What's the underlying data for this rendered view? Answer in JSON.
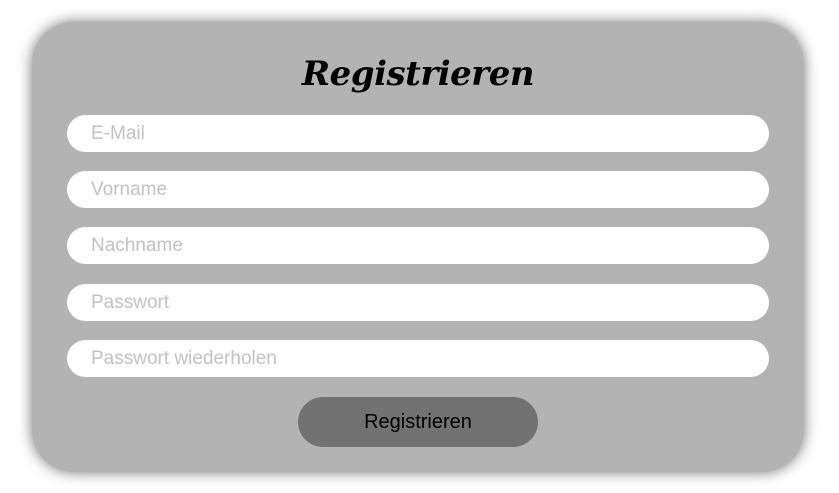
{
  "form": {
    "title": "Registrieren",
    "fields": [
      {
        "placeholder": "E-Mail",
        "value": ""
      },
      {
        "placeholder": "Vorname",
        "value": ""
      },
      {
        "placeholder": "Nachname",
        "value": ""
      },
      {
        "placeholder": "Passwort",
        "value": ""
      },
      {
        "placeholder": "Passwort wiederholen",
        "value": ""
      }
    ],
    "submit_label": "Registrieren"
  },
  "colors": {
    "card_background": "#b3b3b3",
    "input_background": "#ffffff",
    "placeholder_text": "#c2c2c2",
    "button_background": "#727272",
    "title_text": "#000000"
  }
}
